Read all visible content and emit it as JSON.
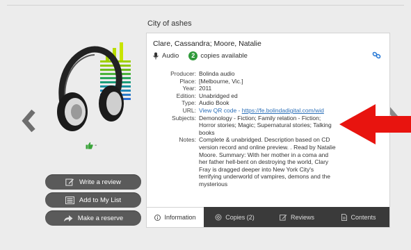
{
  "book": {
    "title": "City of ashes",
    "authors": "Clare, Cassandra; Moore, Natalie",
    "format": "Audio",
    "copies_count": "2",
    "copies_label": "copies available"
  },
  "details": [
    {
      "key": "Producer:",
      "value": "Bolinda audio"
    },
    {
      "key": "Place:",
      "value": "[Melbourne, Vic.]"
    },
    {
      "key": "Year:",
      "value": "2011"
    },
    {
      "key": "Edition:",
      "value": "Unabridged ed"
    },
    {
      "key": "Type:",
      "value": "Audio Book"
    },
    {
      "key": "URL:",
      "value_prefix": "View QR code - ",
      "value_link": "https://fe.bolindadigital.com/wid"
    },
    {
      "key": "Subjects:",
      "value": "Demonology - Fiction; Family relation - Fiction; Horror stories; Magic; Supernatural stories; Talking books"
    },
    {
      "key": "Notes:",
      "value": "Complete & unabridged. Description based on CD version record and online preview. . Read by Natalie Moore. Summary: With her mother in a coma and her father hell-bent on destroying the world, Clary Fray is dragged deeper into New York City's terrifying underworld of vampires, demons and the mysterious"
    }
  ],
  "rating": {
    "label": "-"
  },
  "actions": {
    "write_review": "Write a review",
    "add_list": "Add to My List",
    "reserve": "Make a reserve"
  },
  "tabs": [
    {
      "label": "Information",
      "icon": "info-icon",
      "active": true
    },
    {
      "label": "Copies (2)",
      "icon": "copies-icon",
      "active": false
    },
    {
      "label": "Reviews",
      "icon": "edit-icon",
      "active": false
    },
    {
      "label": "Contents",
      "icon": "document-icon",
      "active": false
    }
  ],
  "colors": {
    "background": "#ececec",
    "button": "#5a5a5a",
    "available_badge": "#2f9a3a",
    "link": "#2b6fb8",
    "tab_bar": "#3a3a3a",
    "annotation_arrow": "#e8140f"
  }
}
